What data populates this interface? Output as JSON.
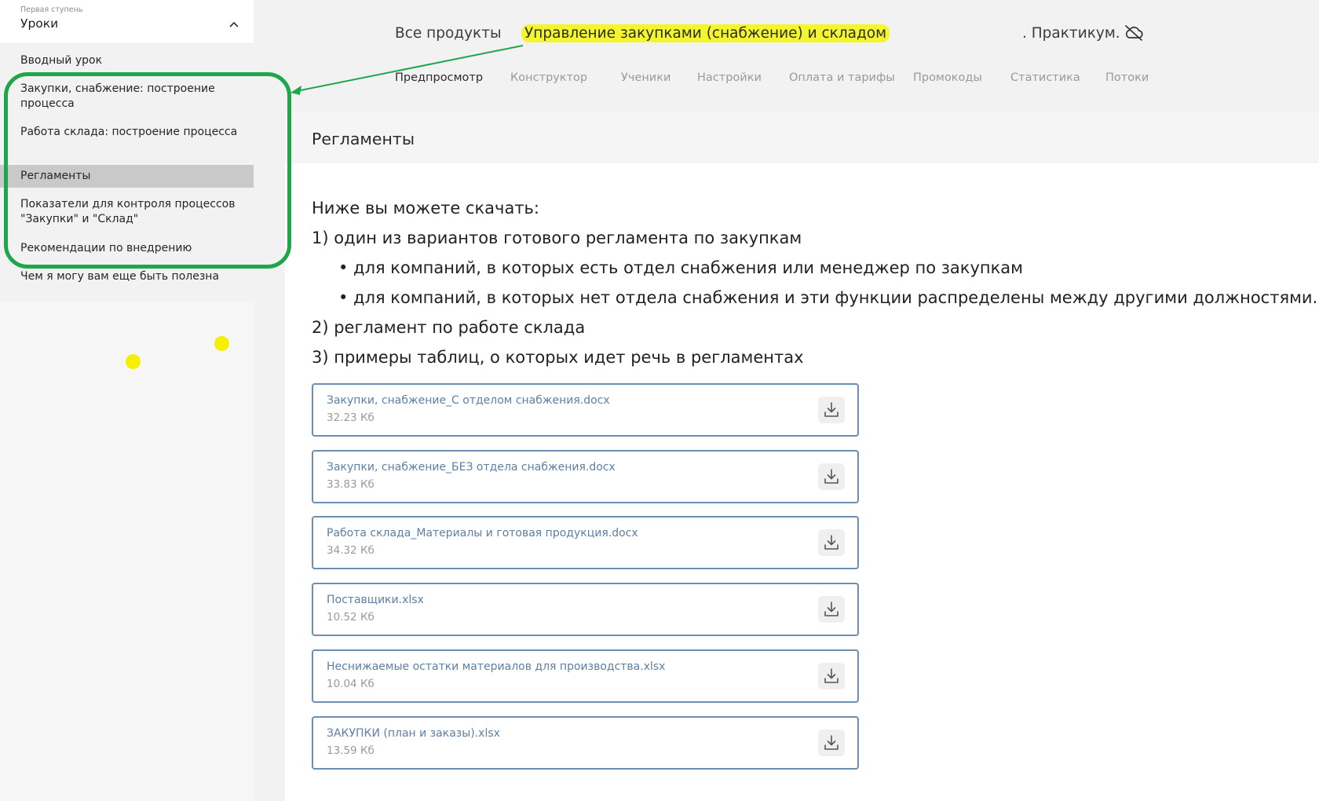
{
  "sidebar": {
    "subtitle": "Первая ступень",
    "title": "Уроки",
    "items": [
      {
        "label": "Вводный урок"
      },
      {
        "label": "Закупки, снабжение: построение процесса"
      },
      {
        "label": "Работа склада: построение процесса"
      },
      {
        "label": "Регламенты"
      },
      {
        "label": "Показатели для контроля процессов \"Закупки\" и \"Склад\""
      },
      {
        "label": "Рекомендации по внедрению"
      },
      {
        "label": "Чем я могу вам еще быть полезна"
      }
    ],
    "active_index": 3
  },
  "header": {
    "all_products": "Все продукты",
    "course_title": "Управление закупками (снабжение) и складом",
    "course_suffix": ". Практикум.",
    "tabs": [
      {
        "label": "Предпросмотр"
      },
      {
        "label": "Конструктор"
      },
      {
        "label": "Ученики"
      },
      {
        "label": "Настройки"
      },
      {
        "label": "Оплата и тарифы"
      },
      {
        "label": "Промокоды"
      },
      {
        "label": "Статистика"
      },
      {
        "label": "Потоки"
      }
    ],
    "active_tab_index": 0
  },
  "lesson": {
    "title": "Регламенты",
    "lines": [
      "Ниже вы можете скачать:",
      "1) один из вариантов готового регламента по закупкам",
      "• для компаний, в которых есть отдел снабжения или менеджер по закупкам",
      "• для компаний, в которых нет отдела снабжения и эти функции распределены между другими должностями.",
      "2) регламент по работе склада",
      "3) примеры таблиц, о которых идет речь в регламентах"
    ],
    "files": [
      {
        "name": "Закупки, снабжение_С отделом снабжения.docx",
        "size": "32.23 Кб"
      },
      {
        "name": "Закупки, снабжение_БЕЗ отдела снабжения.docx",
        "size": "33.83 Кб"
      },
      {
        "name": "Работа склада_Материалы и готовая продукция.docx",
        "size": "34.32 Кб"
      },
      {
        "name": "Поставщики.xlsx",
        "size": "10.52 Кб"
      },
      {
        "name": "Неснижаемые остатки материалов для производства.xlsx",
        "size": "10.04 Кб"
      },
      {
        "name": "ЗАКУПКИ (план и заказы).xlsx",
        "size": "13.59 Кб"
      }
    ]
  },
  "icons": {
    "collapse": "chevron-up-icon",
    "sync": "cloud-off-icon",
    "download": "download-icon"
  },
  "colors": {
    "highlight": "#f5f52c",
    "annotation": "#1fa54a",
    "file_border": "#6c8fb0",
    "file_name": "#5d7fa3"
  }
}
